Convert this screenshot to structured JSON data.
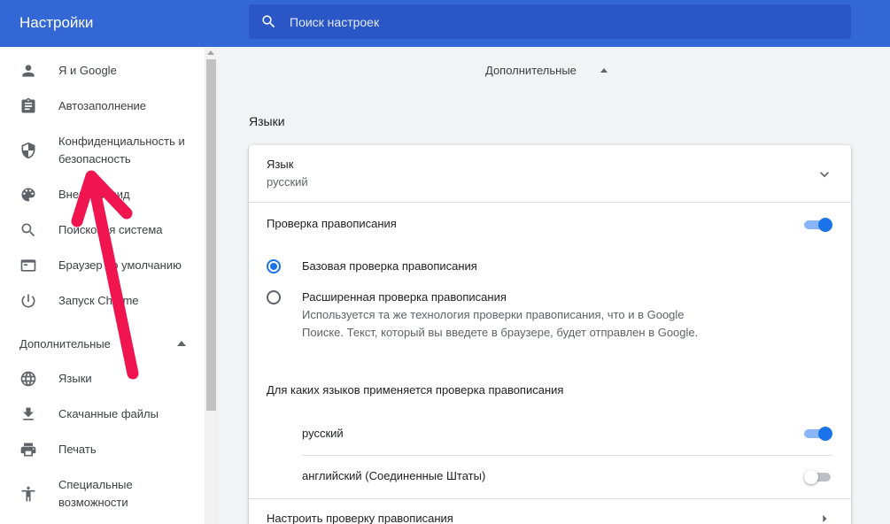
{
  "header": {
    "title": "Настройки",
    "search_placeholder": "Поиск настроек"
  },
  "sidebar": {
    "items": [
      {
        "label": "Я и Google",
        "icon": "person-icon"
      },
      {
        "label": "Автозаполнение",
        "icon": "clipboard-icon"
      },
      {
        "label": "Конфиденциальность и безопасность",
        "icon": "shield-icon"
      },
      {
        "label": "Внешний вид",
        "icon": "palette-icon"
      },
      {
        "label": "Поисковая система",
        "icon": "search-icon"
      },
      {
        "label": "Браузер по умолчанию",
        "icon": "browser-icon"
      },
      {
        "label": "Запуск Chrome",
        "icon": "power-icon"
      }
    ],
    "advanced_label": "Дополнительные",
    "advanced_items": [
      {
        "label": "Языки",
        "icon": "globe-icon"
      },
      {
        "label": "Скачанные файлы",
        "icon": "download-icon"
      },
      {
        "label": "Печать",
        "icon": "printer-icon"
      },
      {
        "label": "Специальные возможности",
        "icon": "accessibility-icon"
      }
    ]
  },
  "main": {
    "advanced_toggle": "Дополнительные",
    "section_title": "Языки",
    "language": {
      "label": "Язык",
      "value": "русский"
    },
    "spellcheck": {
      "label": "Проверка правописания",
      "enabled": true,
      "options": [
        {
          "label": "Базовая проверка правописания",
          "checked": true
        },
        {
          "label": "Расширенная проверка правописания",
          "checked": false,
          "description": "Используется та же технология проверки правописания, что и в Google Поиске. Текст, который вы введете в браузере, будет отправлен в Google."
        }
      ],
      "languages_heading": "Для каких языков применяется проверка правописания",
      "languages": [
        {
          "name": "русский",
          "enabled": true
        },
        {
          "name": "английский (Соединенные Штаты)",
          "enabled": false
        }
      ],
      "customize_label": "Настроить проверку правописания"
    }
  },
  "colors": {
    "header": "#3367d6",
    "accent": "#1a73e8",
    "annotation_arrow": "#f0154f"
  }
}
